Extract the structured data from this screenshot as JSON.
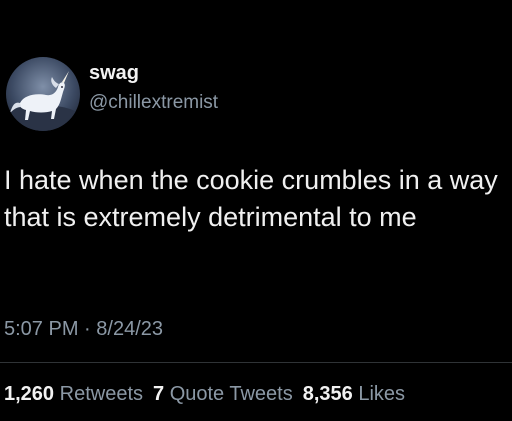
{
  "author": {
    "display_name": "swag",
    "handle": "@chillextremist",
    "avatar_icon": "unicorn-avatar-icon"
  },
  "tweet": {
    "text": "I hate when the cookie crumbles in a way that is extremely detrimental to me",
    "timestamp": "5:07 PM",
    "separator": "·",
    "date": "8/24/23"
  },
  "stats": {
    "retweets_count": "1,260",
    "retweets_label": "Retweets",
    "quote_tweets_count": "7",
    "quote_tweets_label": "Quote Tweets",
    "likes_count": "8,356",
    "likes_label": "Likes"
  },
  "colors": {
    "background": "#000000",
    "primary_text": "#e7e9ea",
    "secondary_text": "#8b98a5",
    "divider": "#2f3336"
  }
}
